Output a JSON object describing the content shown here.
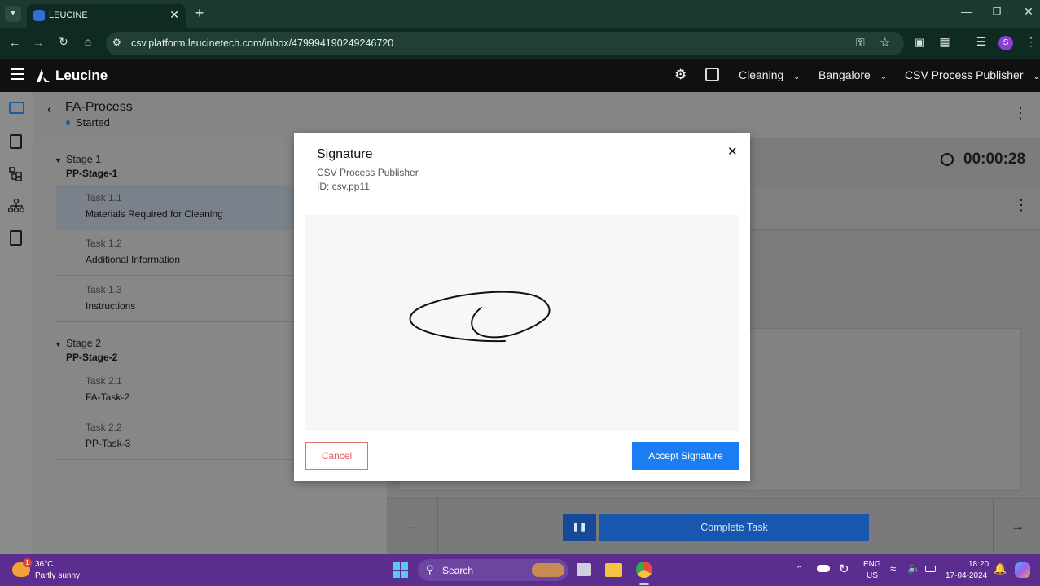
{
  "browser": {
    "tab_title": "LEUCINE",
    "url": "csv.platform.leucinetech.com/inbox/479994190249246720",
    "profile_initial": "S"
  },
  "app": {
    "brand": "Leucine",
    "header": {
      "facility": "Cleaning",
      "location": "Bangalore",
      "user_role": "CSV Process Publisher"
    }
  },
  "page": {
    "title": "FA-Process",
    "status": "Started",
    "timer": "00:00:28"
  },
  "stages": [
    {
      "label": "Stage 1",
      "name": "PP-Stage-1",
      "tasks": [
        {
          "number": "Task 1.1",
          "name": "Materials Required for Cleaning"
        },
        {
          "number": "Task 1.2",
          "name": "Additional Information"
        },
        {
          "number": "Task 1.3",
          "name": "Instructions"
        }
      ]
    },
    {
      "label": "Stage 2",
      "name": "PP-Stage-2",
      "tasks": [
        {
          "number": "Task 2.1",
          "name": "FA-Task-2"
        },
        {
          "number": "Task 2.2",
          "name": "PP-Task-3"
        }
      ]
    }
  ],
  "footer": {
    "complete_label": "Complete Task"
  },
  "modal": {
    "title": "Signature",
    "subtitle": "CSV Process Publisher",
    "id_line": "ID: csv.pp11",
    "cancel_label": "Cancel",
    "accept_label": "Accept Signature"
  },
  "taskbar": {
    "temperature": "36°C",
    "weather": "Partly sunny",
    "weather_badge": "1",
    "search_label": "Search",
    "lang_top": "ENG",
    "lang_bottom": "US",
    "time": "18:20",
    "date": "17-04-2024"
  }
}
